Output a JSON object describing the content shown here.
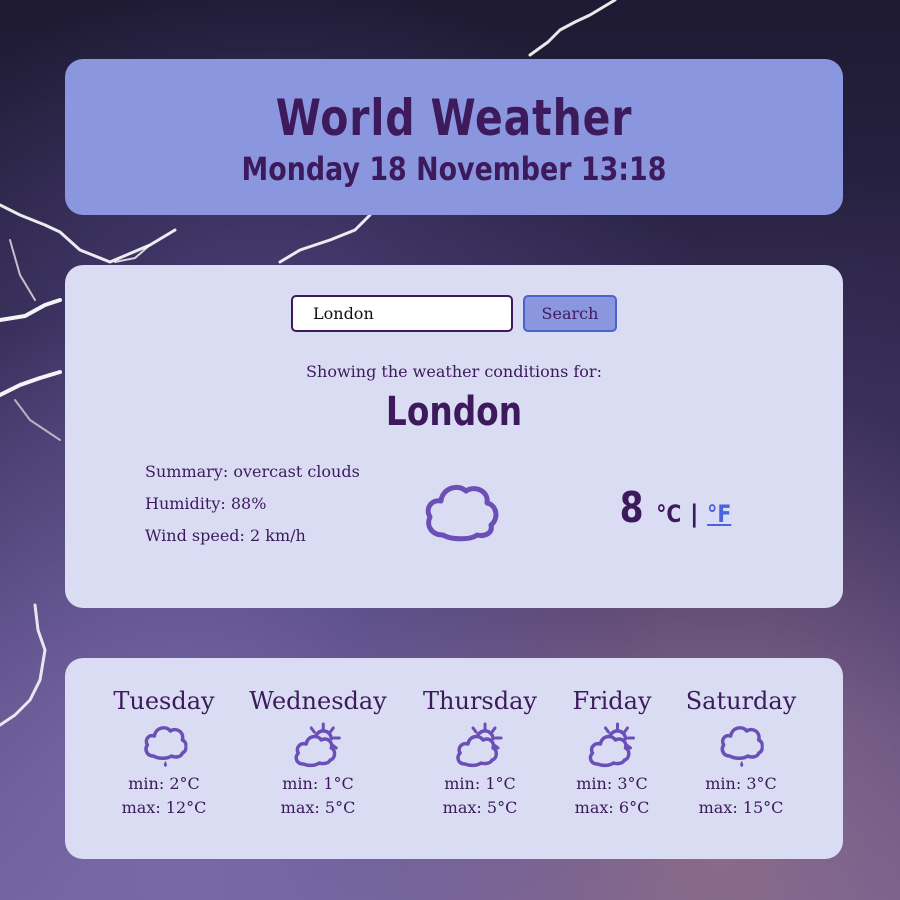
{
  "header": {
    "title": "World Weather",
    "datetime": "Monday 18 November 13:18"
  },
  "search": {
    "value": "London",
    "button_label": "Search"
  },
  "current": {
    "showing_label": "Showing the weather conditions for:",
    "city": "London",
    "summary": "Summary: overcast clouds",
    "humidity": "Humidity: 88%",
    "wind": "Wind speed: 2 km/h",
    "icon": "cloud-icon",
    "temperature": "8",
    "unit_celsius": "°C",
    "unit_separator": "|",
    "unit_fahrenheit": "°F"
  },
  "forecast": [
    {
      "day": "Tuesday",
      "icon": "rain-cloud-icon",
      "min": "min: 2°C",
      "max": "max: 12°C"
    },
    {
      "day": "Wednesday",
      "icon": "sun-behind-cloud-icon",
      "min": "min: 1°C",
      "max": "max: 5°C"
    },
    {
      "day": "Thursday",
      "icon": "sun-behind-cloud-icon",
      "min": "min: 1°C",
      "max": "max: 5°C"
    },
    {
      "day": "Friday",
      "icon": "sun-behind-cloud-icon",
      "min": "min: 3°C",
      "max": "max: 6°C"
    },
    {
      "day": "Saturday",
      "icon": "rain-cloud-icon",
      "min": "min: 3°C",
      "max": "max: 15°C"
    }
  ],
  "colors": {
    "header_bg": "#8a97df",
    "card_bg": "#d9dcf3",
    "text": "#3d1a5c",
    "icon": "#6a4fb6",
    "link": "#4a63e0"
  }
}
